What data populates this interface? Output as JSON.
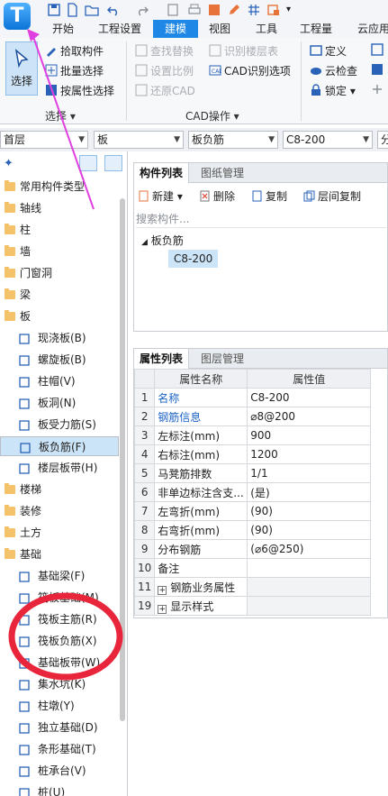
{
  "app": {
    "logo_letter": "T"
  },
  "tabs": [
    "开始",
    "工程设置",
    "建模",
    "视图",
    "工具",
    "工程量",
    "云应用"
  ],
  "active_tab": "建模",
  "ribbon": {
    "select_group": {
      "big_button": "选择",
      "items": [
        "拾取构件",
        "批量选择",
        "按属性选择"
      ],
      "label": "选择"
    },
    "cad_group": {
      "items": [
        "查找替换",
        "识别楼层表",
        "设置比例",
        "CAD识别选项",
        "还原CAD"
      ],
      "label": "CAD操作"
    },
    "right_group": {
      "items": [
        "定义",
        "云检查",
        "锁定"
      ]
    }
  },
  "selectors": [
    "首层",
    "板",
    "板负筋",
    "C8-200",
    "分"
  ],
  "tree": [
    {
      "label": "常用构件类型",
      "kind": "folder"
    },
    {
      "label": "轴线",
      "kind": "folder"
    },
    {
      "label": "柱",
      "kind": "folder"
    },
    {
      "label": "墙",
      "kind": "folder"
    },
    {
      "label": "门窗洞",
      "kind": "folder"
    },
    {
      "label": "梁",
      "kind": "folder"
    },
    {
      "label": "板",
      "kind": "open"
    },
    {
      "label": "现浇板(B)",
      "kind": "child"
    },
    {
      "label": "螺旋板(B)",
      "kind": "child"
    },
    {
      "label": "柱帽(V)",
      "kind": "child"
    },
    {
      "label": "板洞(N)",
      "kind": "child"
    },
    {
      "label": "板受力筋(S)",
      "kind": "child"
    },
    {
      "label": "板负筋(F)",
      "kind": "child",
      "selected": true
    },
    {
      "label": "楼层板带(H)",
      "kind": "child"
    },
    {
      "label": "楼梯",
      "kind": "folder"
    },
    {
      "label": "装修",
      "kind": "folder"
    },
    {
      "label": "土方",
      "kind": "folder"
    },
    {
      "label": "基础",
      "kind": "open"
    },
    {
      "label": "基础梁(F)",
      "kind": "child"
    },
    {
      "label": "筏板基础(M)",
      "kind": "child"
    },
    {
      "label": "筏板主筋(R)",
      "kind": "child"
    },
    {
      "label": "筏板负筋(X)",
      "kind": "child"
    },
    {
      "label": "基础板带(W)",
      "kind": "child"
    },
    {
      "label": "集水坑(K)",
      "kind": "child"
    },
    {
      "label": "柱墩(Y)",
      "kind": "child"
    },
    {
      "label": "独立基础(D)",
      "kind": "child"
    },
    {
      "label": "条形基础(T)",
      "kind": "child"
    },
    {
      "label": "桩承台(V)",
      "kind": "child"
    },
    {
      "label": "桩(U)",
      "kind": "child"
    }
  ],
  "component_panel": {
    "tabs": [
      "构件列表",
      "图纸管理"
    ],
    "tools": [
      "新建",
      "删除",
      "复制",
      "层间复制"
    ],
    "search_placeholder": "搜索构件...",
    "tree_root": "板负筋",
    "tree_item": "C8-200"
  },
  "property_panel": {
    "tabs": [
      "属性列表",
      "图层管理"
    ],
    "headers": [
      "属性名称",
      "属性值"
    ],
    "rows": [
      {
        "num": "1",
        "name": "名称",
        "value": "C8-200",
        "link": true
      },
      {
        "num": "2",
        "name": "钢筋信息",
        "value": "\u0000",
        "link": true
      },
      {
        "num": "3",
        "name": "左标注(mm)",
        "value": "900"
      },
      {
        "num": "4",
        "name": "右标注(mm)",
        "value": "1200"
      },
      {
        "num": "5",
        "name": "马凳筋排数",
        "value": "1/1"
      },
      {
        "num": "6",
        "name": "非单边标注含支...",
        "value": "(是)"
      },
      {
        "num": "7",
        "name": "左弯折(mm)",
        "value": "(90)"
      },
      {
        "num": "8",
        "name": "右弯折(mm)",
        "value": "(90)"
      },
      {
        "num": "9",
        "name": "分布钢筋",
        "value": "(\u0000)"
      },
      {
        "num": "10",
        "name": "备注",
        "value": ""
      },
      {
        "num": "11",
        "name": "钢筋业务属性",
        "value": "",
        "group": true
      },
      {
        "num": "19",
        "name": "显示样式",
        "value": "",
        "group": true
      }
    ],
    "rebar_value": "⌀8@200",
    "distribution_value": "(⌀6@250)"
  },
  "colors": {
    "accent": "#1f87e5",
    "annotation_arrow": "#e040e0",
    "annotation_circle": "#e8253a"
  }
}
